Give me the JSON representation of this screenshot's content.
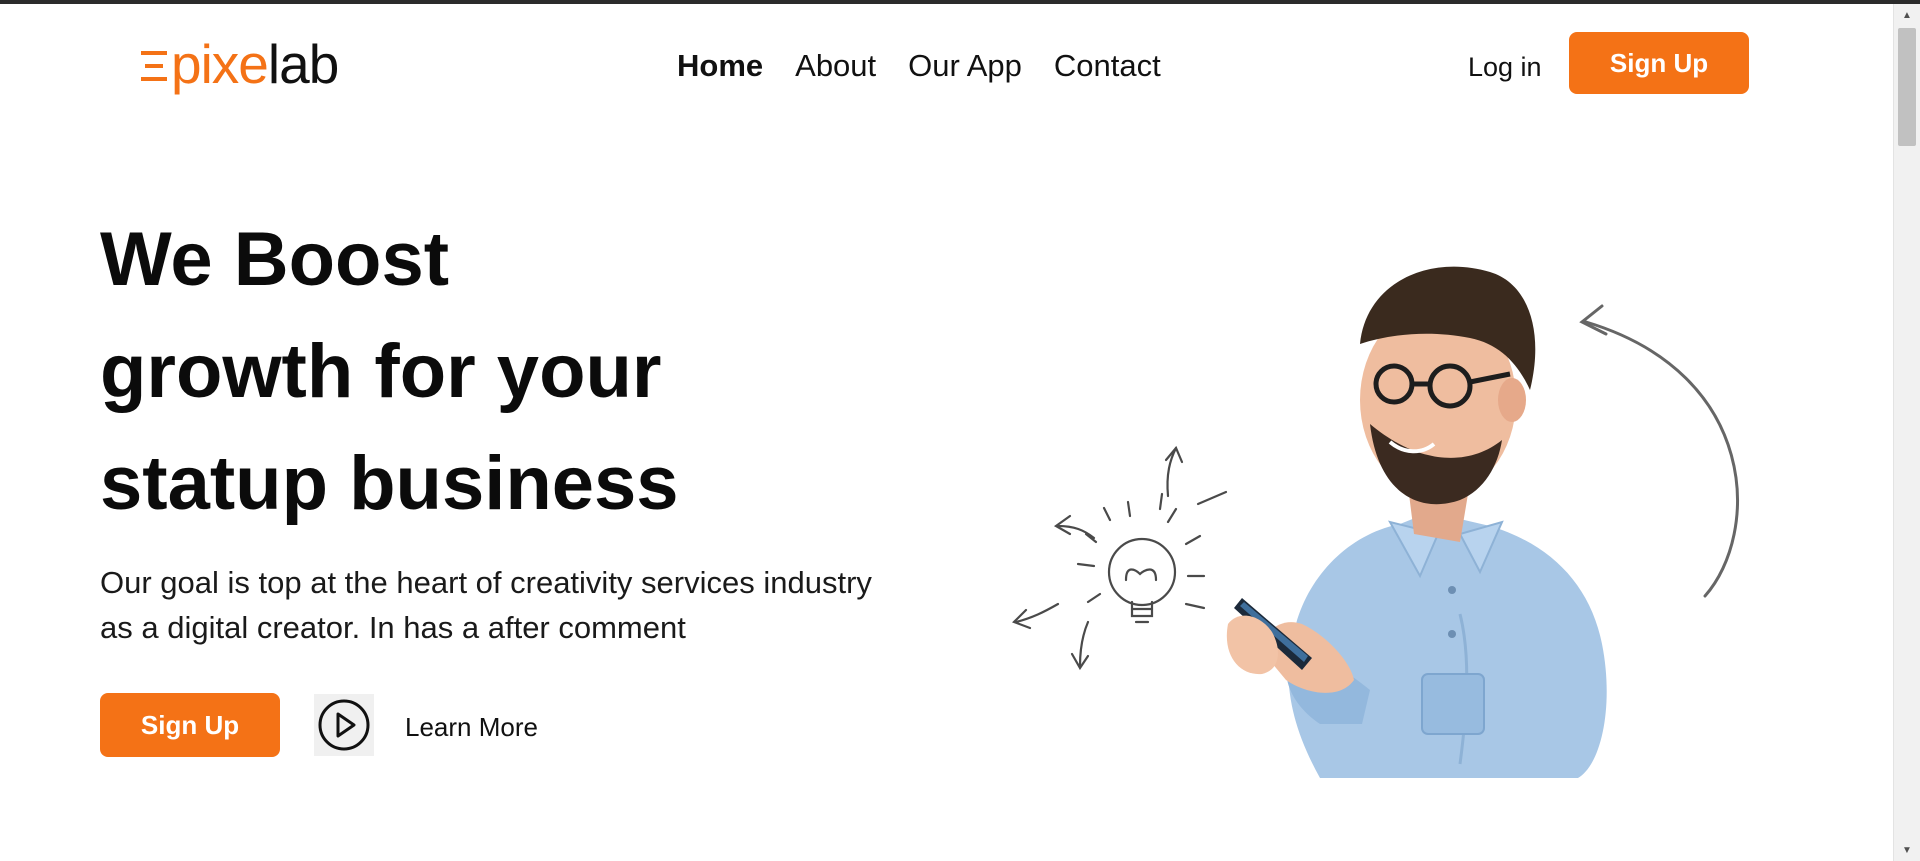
{
  "brand": {
    "logo_text": "epixelab",
    "logo_accent_part": "pixe",
    "logo_dark_part": "lab",
    "accent_color": "#f47216"
  },
  "nav": {
    "items": [
      {
        "label": "Home",
        "active": true
      },
      {
        "label": "About",
        "active": false
      },
      {
        "label": "Our App",
        "active": false
      },
      {
        "label": "Contact",
        "active": false
      }
    ]
  },
  "header": {
    "login_label": "Log in",
    "signup_label": "Sign Up"
  },
  "hero": {
    "title_lines": [
      "We Boost",
      "growth for your",
      "statup business"
    ],
    "subtitle_lines": [
      "Our goal is top at the heart of creativity services industry",
      "as a digital creator. In has a after comment"
    ],
    "signup_label": "Sign Up",
    "learn_more_label": "Learn More",
    "play_icon": "play-circle-icon"
  },
  "illustration": {
    "subject": "man-with-phone-photo",
    "doodles": [
      "lightbulb-icon",
      "curved-arrow-icon"
    ]
  },
  "colors": {
    "accent": "#f47216",
    "text": "#111111",
    "shirt": "#a8c7e6"
  }
}
